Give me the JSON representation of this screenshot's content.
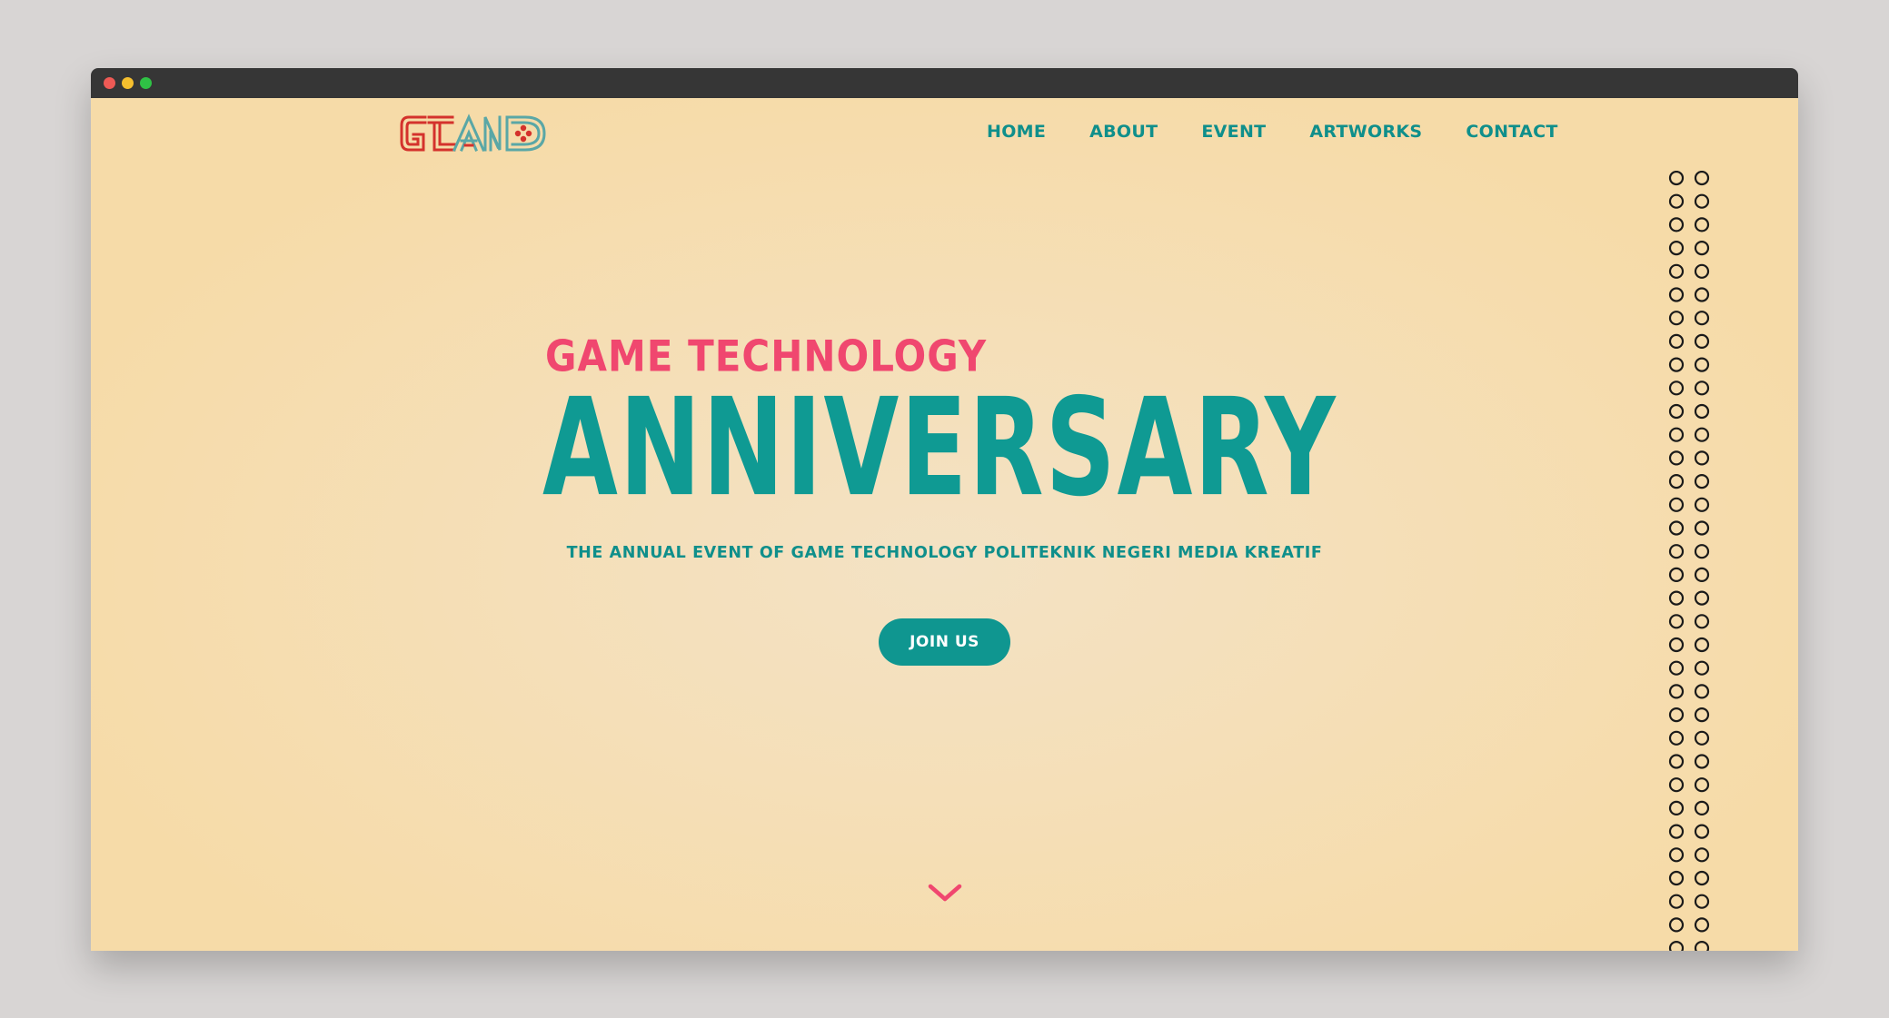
{
  "window": {
    "controls": [
      "close",
      "minimize",
      "maximize"
    ]
  },
  "logo": {
    "text": "GTAND",
    "icon": "gamepad-icon",
    "colors": {
      "red": "#d4322c",
      "teal": "#5aa7a6"
    }
  },
  "nav": {
    "items": [
      {
        "label": "HOME"
      },
      {
        "label": "ABOUT"
      },
      {
        "label": "EVENT"
      },
      {
        "label": "ARTWORKS"
      },
      {
        "label": "CONTACT"
      }
    ]
  },
  "hero": {
    "subtitle": "GAME TECHNOLOGY",
    "title": "ANNIVERSARY",
    "description": "THE ANNUAL EVENT OF GAME TECHNOLOGY POLITEKNIK NEGERI MEDIA KREATIF",
    "button_label": "JOIN US",
    "scroll_icon": "chevron-down-icon"
  },
  "colors": {
    "accent_teal": "#0f9a93",
    "accent_pink": "#f0476f",
    "background": "#f6dba8"
  }
}
